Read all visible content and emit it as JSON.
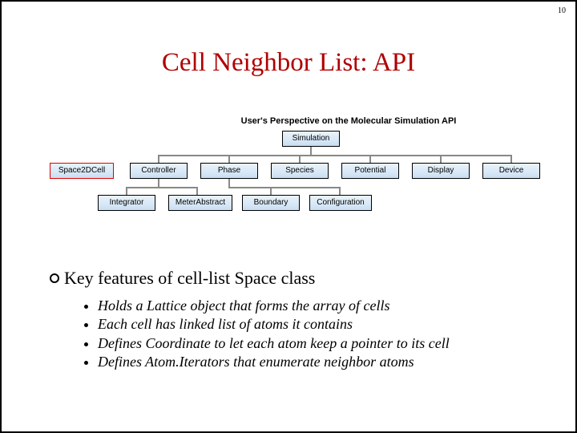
{
  "page_number": "10",
  "title": "Cell Neighbor List:  API",
  "diagram": {
    "title": "User's Perspective on the Molecular Simulation API",
    "root": "Simulation",
    "left_extra": "Space2DCell",
    "row2": [
      "Controller",
      "Phase",
      "Species",
      "Potential",
      "Display",
      "Device"
    ],
    "row3": [
      "Integrator",
      "MeterAbstract",
      "Boundary",
      "Configuration"
    ]
  },
  "lead": "Key features of cell-list Space class",
  "bullets": [
    "Holds a Lattice object that forms the array of cells",
    "Each cell has linked list of atoms it contains",
    "Defines Coordinate to let each atom keep a pointer to its cell",
    "Defines Atom.Iterators that enumerate neighbor atoms"
  ]
}
